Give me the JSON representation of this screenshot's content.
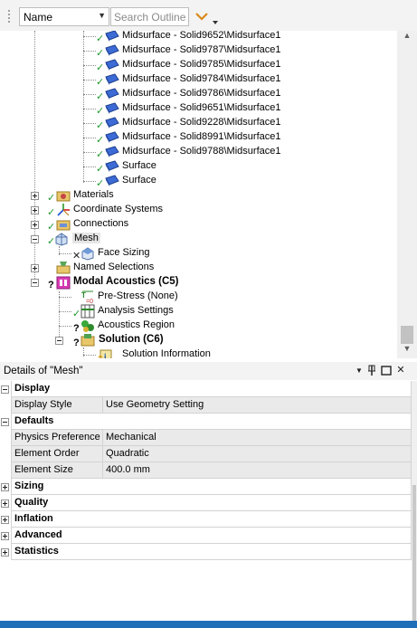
{
  "toolbar": {
    "name_filter": "Name",
    "search_placeholder": "Search Outline"
  },
  "tree": {
    "bodies": [
      "Midsurface - Solid9652\\Midsurface1",
      "Midsurface - Solid9787\\Midsurface1",
      "Midsurface - Solid9785\\Midsurface1",
      "Midsurface - Solid9784\\Midsurface1",
      "Midsurface - Solid9786\\Midsurface1",
      "Midsurface - Solid9651\\Midsurface1",
      "Midsurface - Solid9228\\Midsurface1",
      "Midsurface - Solid8991\\Midsurface1",
      "Midsurface - Solid9788\\Midsurface1",
      "Surface",
      "Surface"
    ],
    "materials": "Materials",
    "coordinate_systems": "Coordinate Systems",
    "connections": "Connections",
    "mesh": "Mesh",
    "face_sizing": "Face Sizing",
    "named_selections": "Named Selections",
    "modal_acoustics": "Modal Acoustics (C5)",
    "pre_stress": "Pre-Stress (None)",
    "analysis_settings": "Analysis Settings",
    "acoustics_region": "Acoustics Region",
    "solution": "Solution (C6)",
    "solution_information": "Solution Information",
    "status_question": "?"
  },
  "details": {
    "title": "Details of \"Mesh\"",
    "pin_glyph": "⬇",
    "close_glyph": "✕",
    "display": {
      "label": "Display",
      "rows": [
        {
          "name": "Display Style",
          "value": "Use Geometry Setting"
        }
      ]
    },
    "defaults": {
      "label": "Defaults",
      "rows": [
        {
          "name": "Physics Preference",
          "value": "Mechanical"
        },
        {
          "name": "Element Order",
          "value": "Quadratic"
        },
        {
          "name": "Element Size",
          "value": "400.0 mm"
        }
      ]
    },
    "collapsed_groups": [
      "Sizing",
      "Quality",
      "Inflation",
      "Advanced",
      "Statistics"
    ]
  },
  "colors": {
    "check": "#1f9a2f",
    "body_icon": "#3d6bd6",
    "cross": "#222222",
    "accent_bar": "#1e6fb8",
    "dropdown_orange": "#d88a1b"
  }
}
